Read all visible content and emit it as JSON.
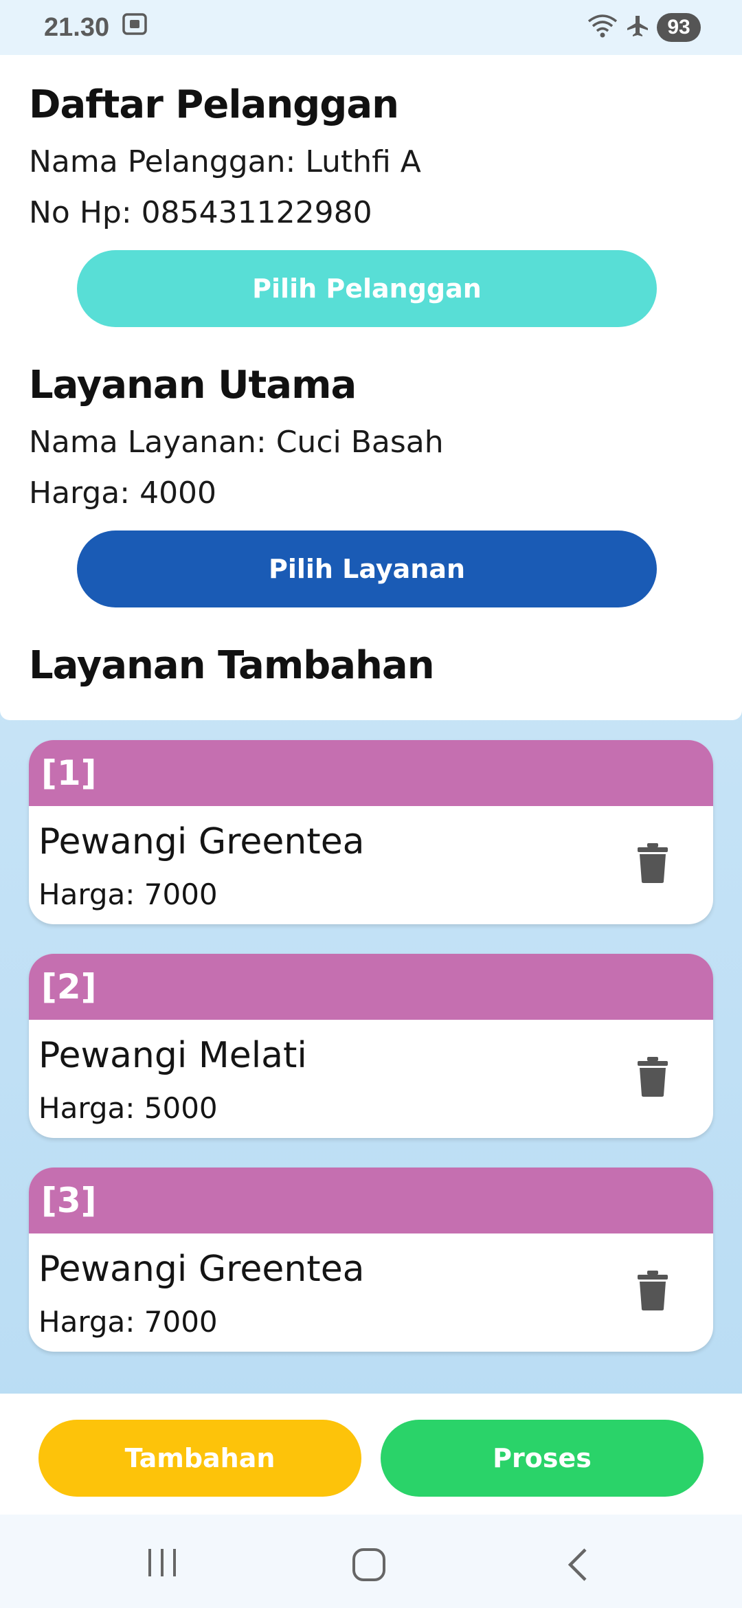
{
  "status_bar": {
    "time": "21.30",
    "battery": "93",
    "icons": [
      "screenshot-icon",
      "wifi-icon",
      "airplane-icon",
      "battery-icon"
    ]
  },
  "customer": {
    "title": "Daftar Pelanggan",
    "name_line": "Nama Pelanggan: Luthfi A",
    "phone_line": "No Hp: 085431122980",
    "button_label": "Pilih Pelanggan"
  },
  "main_service": {
    "title": "Layanan Utama",
    "name_line": "Nama Layanan: Cuci Basah",
    "price_line": "Harga: 4000",
    "button_label": "Pilih Layanan"
  },
  "additional": {
    "title": "Layanan Tambahan",
    "items": [
      {
        "index": "[1]",
        "name": "Pewangi Greentea",
        "price": "Harga: 7000"
      },
      {
        "index": "[2]",
        "name": "Pewangi Melati",
        "price": "Harga: 5000"
      },
      {
        "index": "[3]",
        "name": "Pewangi Greentea",
        "price": "Harga: 7000"
      }
    ]
  },
  "actions": {
    "add_label": "Tambahan",
    "process_label": "Proses"
  },
  "colors": {
    "cyan_button": "#58ded6",
    "blue_button": "#1a5bb5",
    "card_header": "#c56fb0",
    "yellow_button": "#fdc30a",
    "green_button": "#2ad369"
  },
  "nav_bar": {
    "icons": [
      "recent-apps-icon",
      "home-icon",
      "back-icon"
    ]
  }
}
